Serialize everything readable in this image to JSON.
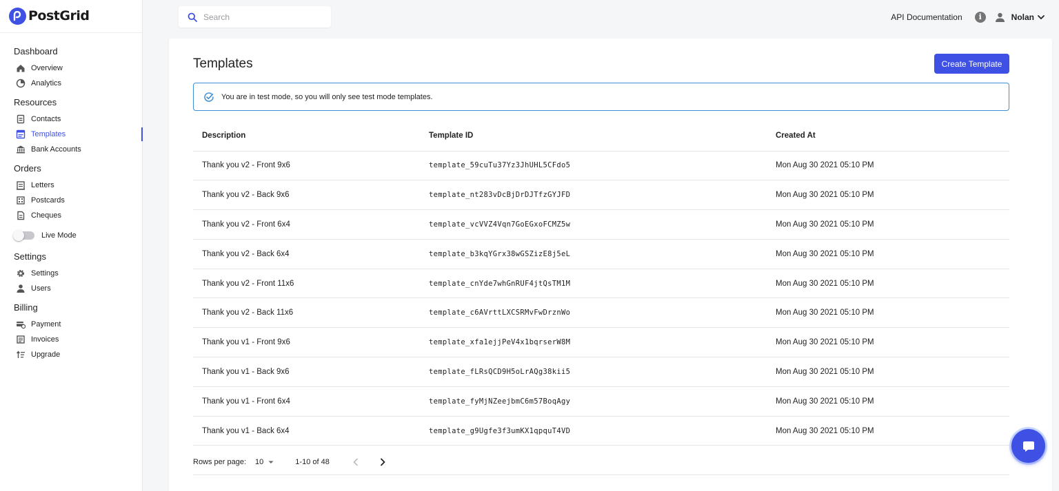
{
  "brand": {
    "name": "PostGrid",
    "accent": "#3f51e5"
  },
  "sidebar": {
    "sections": [
      {
        "title": "Dashboard",
        "items": [
          {
            "label": "Overview",
            "icon": "home-icon"
          },
          {
            "label": "Analytics",
            "icon": "pie-chart-icon"
          }
        ]
      },
      {
        "title": "Resources",
        "items": [
          {
            "label": "Contacts",
            "icon": "contacts-icon"
          },
          {
            "label": "Templates",
            "icon": "templates-icon",
            "active": true
          },
          {
            "label": "Bank Accounts",
            "icon": "bank-icon"
          }
        ]
      },
      {
        "title": "Orders",
        "items": [
          {
            "label": "Letters",
            "icon": "letter-icon"
          },
          {
            "label": "Postcards",
            "icon": "postcard-icon"
          },
          {
            "label": "Cheques",
            "icon": "cheque-icon"
          }
        ]
      },
      {
        "title": "Settings",
        "items": [
          {
            "label": "Settings",
            "icon": "gear-icon"
          },
          {
            "label": "Users",
            "icon": "user-icon"
          }
        ]
      },
      {
        "title": "Billing",
        "items": [
          {
            "label": "Payment",
            "icon": "payment-icon"
          },
          {
            "label": "Invoices",
            "icon": "invoice-icon"
          },
          {
            "label": "Upgrade",
            "icon": "upgrade-icon"
          }
        ]
      }
    ],
    "live_mode_label": "Live Mode",
    "live_mode_on": false
  },
  "search": {
    "placeholder": "Search",
    "value": ""
  },
  "header": {
    "api_docs": "API Documentation",
    "user_name": "Nolan"
  },
  "main": {
    "title": "Templates",
    "create_button": "Create Template",
    "alert": "You are in test mode, so you will only see test mode templates.",
    "columns": [
      "Description",
      "Template ID",
      "Created At"
    ],
    "rows": [
      [
        "Thank you v2 - Front 9x6",
        "template_59cuTu37Yz3JhUHL5CFdo5",
        "Mon Aug 30 2021 05:10 PM"
      ],
      [
        "Thank you v2 - Back 9x6",
        "template_nt283vDcBjDrDJTfzGYJFD",
        "Mon Aug 30 2021 05:10 PM"
      ],
      [
        "Thank you v2 - Front 6x4",
        "template_vcVVZ4Vqn7GoEGxoFCMZ5w",
        "Mon Aug 30 2021 05:10 PM"
      ],
      [
        "Thank you v2 - Back 6x4",
        "template_b3kqYGrx38wGSZizE8j5eL",
        "Mon Aug 30 2021 05:10 PM"
      ],
      [
        "Thank you v2 - Front 11x6",
        "template_cnYde7whGnRUF4jtQsTM1M",
        "Mon Aug 30 2021 05:10 PM"
      ],
      [
        "Thank you v2 - Back 11x6",
        "template_c6AVrttLXCSRMvFwDrznWo",
        "Mon Aug 30 2021 05:10 PM"
      ],
      [
        "Thank you v1 - Front 9x6",
        "template_xfa1ejjPeV4x1bqrserW8M",
        "Mon Aug 30 2021 05:10 PM"
      ],
      [
        "Thank you v1 - Back 9x6",
        "template_fLRsQCD9H5oLrAQg38kii5",
        "Mon Aug 30 2021 05:10 PM"
      ],
      [
        "Thank you v1 - Front 6x4",
        "template_fyMjNZeejbmC6m57BoqAgy",
        "Mon Aug 30 2021 05:10 PM"
      ],
      [
        "Thank you v1 - Back 6x4",
        "template_g9Ugfe3f3umKX1qpquT4VD",
        "Mon Aug 30 2021 05:10 PM"
      ]
    ],
    "pagination": {
      "rows_per_page_label": "Rows per page:",
      "rows_per_page": "10",
      "range": "1-10 of 48"
    }
  },
  "chat_icon": "chat-bubble-icon"
}
